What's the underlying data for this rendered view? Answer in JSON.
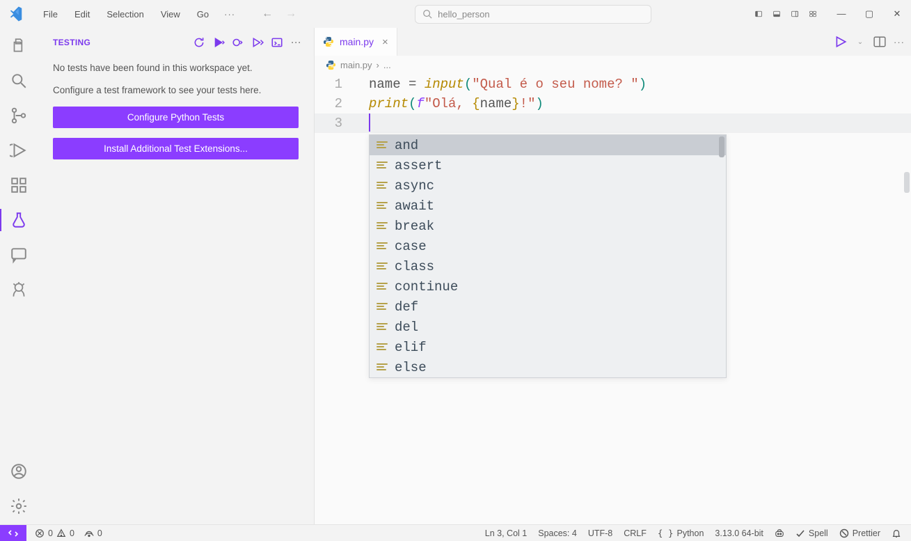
{
  "menu": {
    "file": "File",
    "edit": "Edit",
    "selection": "Selection",
    "view": "View",
    "go": "Go"
  },
  "search": {
    "text": "hello_person"
  },
  "sidebar": {
    "title": "TESTING",
    "msg1": "No tests have been found in this workspace yet.",
    "msg2": "Configure a test framework to see your tests here.",
    "btn1": "Configure Python Tests",
    "btn2": "Install Additional Test Extensions..."
  },
  "tab": {
    "filename": "main.py"
  },
  "breadcrumb": {
    "file": "main.py",
    "sep": "›",
    "more": "..."
  },
  "code": {
    "line_numbers": [
      "1",
      "2",
      "3"
    ],
    "l1": {
      "a": "name ",
      "b": "= ",
      "c": "input",
      "d": "(",
      "e": "\"Qual é o seu nome? \"",
      "f": ")"
    },
    "l2": {
      "a": "print",
      "b": "(",
      "c": "f",
      "d": "\"Olá, ",
      "e": "{",
      "f": "name",
      "g": "}",
      "h": "!\"",
      "i": ")"
    }
  },
  "suggestions": [
    "and",
    "assert",
    "async",
    "await",
    "break",
    "case",
    "class",
    "continue",
    "def",
    "del",
    "elif",
    "else"
  ],
  "status": {
    "errors": "0",
    "warnings": "0",
    "ports": "0",
    "lncol": "Ln 3, Col 1",
    "spaces": "Spaces: 4",
    "encoding": "UTF-8",
    "eol": "CRLF",
    "lang": "Python",
    "interp": "3.13.0 64-bit",
    "spell": "Spell",
    "prettier": "Prettier"
  }
}
